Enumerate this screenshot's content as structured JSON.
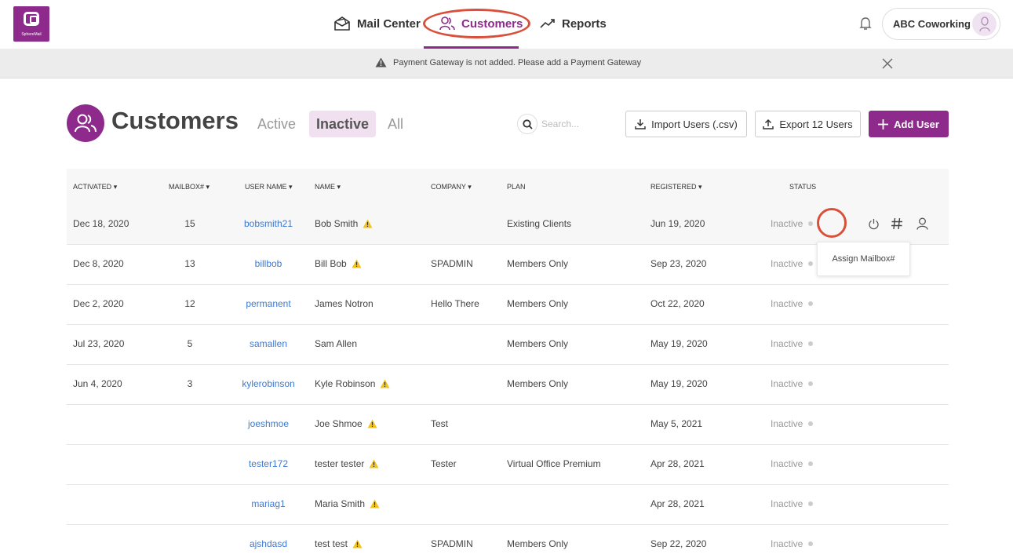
{
  "brand": {
    "name": "SphereMail",
    "color": "#8e2a8b"
  },
  "nav": {
    "items": [
      {
        "label": "Mail Center",
        "icon": "mail-icon"
      },
      {
        "label": "Customers",
        "icon": "users-icon",
        "active": true
      },
      {
        "label": "Reports",
        "icon": "trend-icon"
      }
    ]
  },
  "account": {
    "name": "ABC Coworking"
  },
  "banner": {
    "message": "Payment Gateway is not added. Please add a  Payment Gateway"
  },
  "header": {
    "title": "Customers",
    "filters": [
      "Active",
      "Inactive",
      "All"
    ],
    "selected_filter": "Inactive",
    "search_placeholder": "Search...",
    "import_label": "Import Users (.csv)",
    "export_label": "Export 12 Users",
    "add_label": "Add User"
  },
  "table": {
    "columns": [
      "ACTIVATED",
      "MAILBOX#",
      "USER NAME",
      "NAME",
      "COMPANY",
      "PLAN",
      "REGISTERED",
      "STATUS"
    ],
    "rows": [
      {
        "activated": "Dec 18, 2020",
        "mailbox": "15",
        "username": "bobsmith21",
        "name": "Bob Smith",
        "warn": true,
        "company": "",
        "plan": "Existing Clients",
        "registered": "Jun 19, 2020",
        "status": "Inactive"
      },
      {
        "activated": "Dec 8, 2020",
        "mailbox": "13",
        "username": "billbob",
        "name": "Bill Bob",
        "warn": true,
        "company": "SPADMIN",
        "plan": "Members Only",
        "registered": "Sep 23, 2020",
        "status": "Inactive"
      },
      {
        "activated": "Dec 2, 2020",
        "mailbox": "12",
        "username": "permanent",
        "name": "James Notron",
        "warn": false,
        "company": "Hello There",
        "plan": "Members Only",
        "registered": "Oct 22, 2020",
        "status": "Inactive"
      },
      {
        "activated": "Jul 23, 2020",
        "mailbox": "5",
        "username": "samallen",
        "name": "Sam Allen",
        "warn": false,
        "company": "",
        "plan": "Members Only",
        "registered": "May 19, 2020",
        "status": "Inactive"
      },
      {
        "activated": "Jun 4, 2020",
        "mailbox": "3",
        "username": "kylerobinson",
        "name": "Kyle Robinson",
        "warn": true,
        "company": "",
        "plan": "Members Only",
        "registered": "May 19, 2020",
        "status": "Inactive"
      },
      {
        "activated": "",
        "mailbox": "",
        "username": "joeshmoe",
        "name": "Joe Shmoe",
        "warn": true,
        "company": "Test",
        "plan": "",
        "registered": "May 5, 2021",
        "status": "Inactive"
      },
      {
        "activated": "",
        "mailbox": "",
        "username": "tester172",
        "name": "tester tester",
        "warn": true,
        "company": "Tester",
        "plan": "Virtual Office Premium",
        "registered": "Apr 28, 2021",
        "status": "Inactive"
      },
      {
        "activated": "",
        "mailbox": "",
        "username": "mariag1",
        "name": "Maria Smith",
        "warn": true,
        "company": "",
        "plan": "",
        "registered": "Apr 28, 2021",
        "status": "Inactive"
      },
      {
        "activated": "",
        "mailbox": "",
        "username": "ajshdasd",
        "name": "test test",
        "warn": true,
        "company": "SPADMIN",
        "plan": "Members Only",
        "registered": "Sep 22, 2020",
        "status": "Inactive"
      }
    ]
  },
  "tooltip": {
    "text": "Assign Mailbox#"
  }
}
